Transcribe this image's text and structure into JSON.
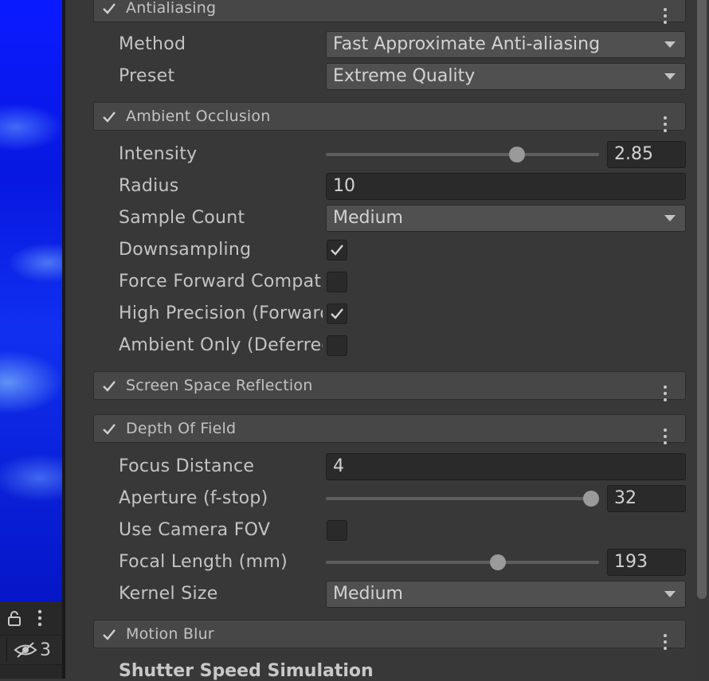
{
  "scene": {
    "hidden_count": "3"
  },
  "sections": {
    "antialiasing": {
      "title": "Antialiasing",
      "method_label": "Method",
      "method_value": "Fast Approximate Anti-aliasing",
      "preset_label": "Preset",
      "preset_value": "Extreme Quality"
    },
    "ambient_occlusion": {
      "title": "Ambient Occlusion",
      "intensity_label": "Intensity",
      "intensity_value": "2.85",
      "intensity_fraction": 0.7,
      "radius_label": "Radius",
      "radius_value": "10",
      "sample_count_label": "Sample Count",
      "sample_count_value": "Medium",
      "downsampling_label": "Downsampling",
      "downsampling_checked": true,
      "force_forward_label": "Force Forward Compatibility",
      "force_forward_checked": false,
      "high_precision_label": "High Precision (Forward)",
      "high_precision_checked": true,
      "ambient_only_label": "Ambient Only (Deferred)",
      "ambient_only_checked": false
    },
    "screen_space_reflection": {
      "title": "Screen Space Reflection"
    },
    "depth_of_field": {
      "title": "Depth Of Field",
      "focus_distance_label": "Focus Distance",
      "focus_distance_value": "4",
      "aperture_label": "Aperture (f-stop)",
      "aperture_value": "32",
      "aperture_fraction": 0.97,
      "use_camera_fov_label": "Use Camera FOV",
      "use_camera_fov_checked": false,
      "focal_length_label": "Focal Length (mm)",
      "focal_length_value": "193",
      "focal_length_fraction": 0.63,
      "kernel_size_label": "Kernel Size",
      "kernel_size_value": "Medium"
    },
    "motion_blur": {
      "title": "Motion Blur",
      "shutter_subhead": "Shutter Speed Simulation"
    }
  },
  "colors": {
    "scene_blue": "#0a1aff",
    "panel_bg": "#383838",
    "header_bg": "#474747"
  }
}
